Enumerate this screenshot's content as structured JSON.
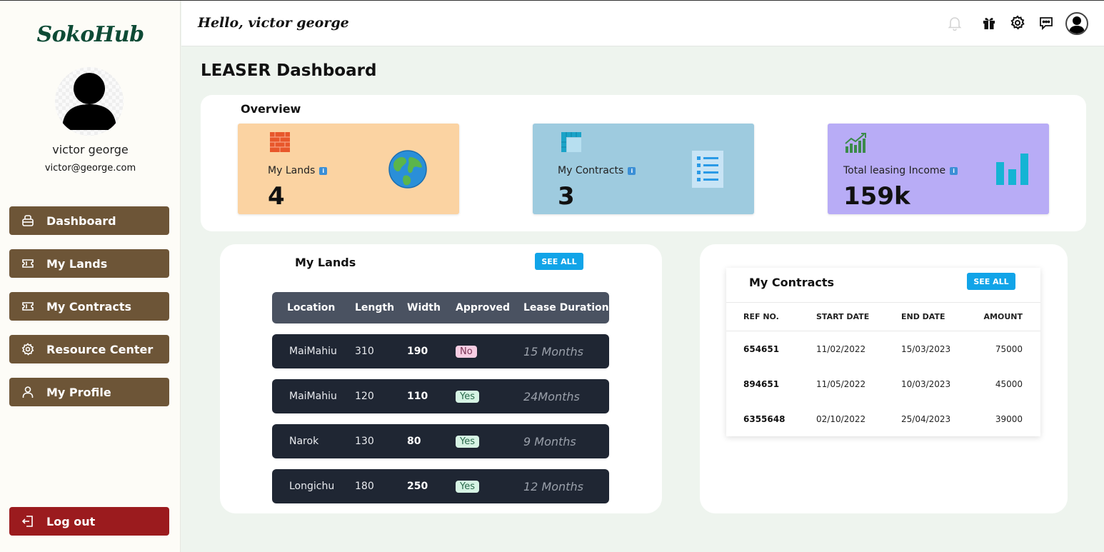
{
  "app": {
    "logo": "SokoHub"
  },
  "user": {
    "name": "victor george",
    "email": "victor@george.com"
  },
  "sidebar": {
    "items": [
      {
        "label": "Dashboard",
        "icon": "dashboard-icon"
      },
      {
        "label": "My Lands",
        "icon": "ticket-icon"
      },
      {
        "label": "My Contracts",
        "icon": "ticket-icon"
      },
      {
        "label": "Resource Center",
        "icon": "gear-icon"
      },
      {
        "label": "My Profile",
        "icon": "user-icon"
      }
    ],
    "logout_label": "Log out"
  },
  "header": {
    "greeting": "Hello, victor george",
    "icons": [
      "bell-icon",
      "gift-icon",
      "settings-icon",
      "chat-icon",
      "avatar-icon"
    ]
  },
  "page": {
    "title": "LEASER Dashboard"
  },
  "overview": {
    "title": "Overview",
    "cards": [
      {
        "label": "My Lands",
        "value": "4",
        "bg": "#fbd3a2",
        "icon": "globe-icon"
      },
      {
        "label": "My Contracts",
        "value": "3",
        "bg": "#9ecbdf",
        "icon": "list-icon"
      },
      {
        "label": "Total leasing Income",
        "value": "159k",
        "bg": "#b8acf6",
        "icon": "bar-chart-icon"
      }
    ]
  },
  "lands": {
    "title": "My Lands",
    "see_all": "SEE ALL",
    "columns": [
      "Location",
      "Length",
      "Width",
      "Approved",
      "Lease Duration"
    ],
    "rows": [
      {
        "location": "MaiMahiu",
        "length": "310",
        "width": "190",
        "approved": "No",
        "duration": "15 Months"
      },
      {
        "location": "MaiMahiu",
        "length": "120",
        "width": "110",
        "approved": "Yes",
        "duration": "24Months"
      },
      {
        "location": "Narok",
        "length": "130",
        "width": "80",
        "approved": "Yes",
        "duration": "9 Months"
      },
      {
        "location": "Longichu",
        "length": "180",
        "width": "250",
        "approved": "Yes",
        "duration": "12 Months"
      }
    ]
  },
  "contracts": {
    "title": "My Contracts",
    "see_all": "SEE ALL",
    "columns": [
      "REF NO.",
      "START DATE",
      "END DATE",
      "AMOUNT"
    ],
    "rows": [
      {
        "ref": "654651",
        "start": "11/02/2022",
        "end": "15/03/2023",
        "amount": "75000"
      },
      {
        "ref": "894651",
        "start": "11/05/2022",
        "end": "10/03/2023",
        "amount": "45000"
      },
      {
        "ref": "6355648",
        "start": "02/10/2022",
        "end": "25/04/2023",
        "amount": "39000"
      }
    ]
  }
}
